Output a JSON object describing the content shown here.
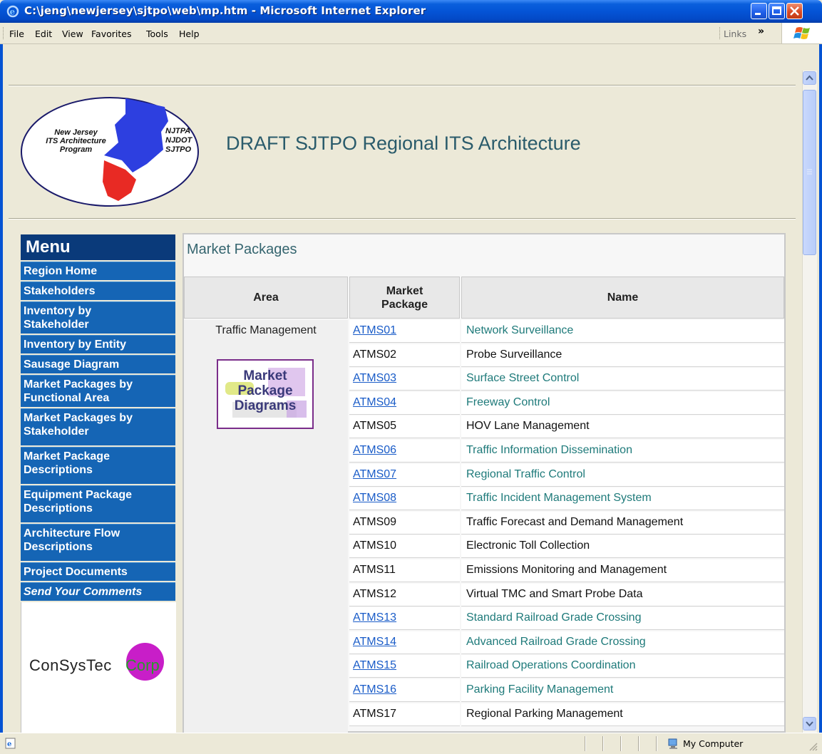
{
  "window": {
    "title": "C:\\jeng\\newjersey\\sjtpo\\web\\mp.htm - Microsoft Internet Explorer"
  },
  "menubar": {
    "items": [
      "File",
      "Edit",
      "View",
      "Favorites",
      "Tools",
      "Help"
    ],
    "links_label": "Links"
  },
  "header": {
    "logo_left": [
      "New Jersey",
      "ITS Architecture",
      "Program"
    ],
    "logo_right": [
      "NJTPA",
      "NJDOT",
      "SJTPO"
    ],
    "title": "DRAFT SJTPO Regional ITS Architecture"
  },
  "sidebar": {
    "heading": "Menu",
    "items": [
      "Region Home",
      "Stakeholders",
      "Inventory by Stakeholder",
      "Inventory by Entity",
      "Sausage Diagram",
      "Market Packages by Functional Area",
      "Market Packages by Stakeholder",
      "Market Package Descriptions",
      "Equipment Package Descriptions",
      "Architecture Flow Descriptions",
      "Project Documents",
      "Send Your Comments"
    ],
    "footer_logo": "ConSysTec",
    "footer_logo_accent": "Corp"
  },
  "main": {
    "section_title": "Market Packages",
    "columns": [
      "Area",
      "Market Package",
      "Name"
    ],
    "area": "Traffic Management",
    "diagram_button": [
      "Market",
      "Package",
      "Diagrams"
    ],
    "rows": [
      {
        "mp": "ATMS01",
        "name": "Network Surveillance",
        "link": true
      },
      {
        "mp": "ATMS02",
        "name": "Probe Surveillance",
        "link": false
      },
      {
        "mp": "ATMS03",
        "name": "Surface Street Control",
        "link": true
      },
      {
        "mp": "ATMS04",
        "name": "Freeway Control",
        "link": true
      },
      {
        "mp": "ATMS05",
        "name": "HOV Lane Management",
        "link": false
      },
      {
        "mp": "ATMS06",
        "name": "Traffic Information Dissemination",
        "link": true
      },
      {
        "mp": "ATMS07",
        "name": "Regional Traffic Control",
        "link": true
      },
      {
        "mp": "ATMS08",
        "name": "Traffic Incident Management System",
        "link": true
      },
      {
        "mp": "ATMS09",
        "name": "Traffic Forecast and Demand Management",
        "link": false
      },
      {
        "mp": "ATMS10",
        "name": "Electronic Toll Collection",
        "link": false
      },
      {
        "mp": "ATMS11",
        "name": "Emissions Monitoring and Management",
        "link": false
      },
      {
        "mp": "ATMS12",
        "name": "Virtual TMC and Smart Probe Data",
        "link": false
      },
      {
        "mp": "ATMS13",
        "name": "Standard Railroad Grade Crossing",
        "link": true
      },
      {
        "mp": "ATMS14",
        "name": "Advanced Railroad Grade Crossing",
        "link": true
      },
      {
        "mp": "ATMS15",
        "name": "Railroad Operations Coordination",
        "link": true
      },
      {
        "mp": "ATMS16",
        "name": "Parking Facility Management",
        "link": true
      },
      {
        "mp": "ATMS17",
        "name": "Regional Parking Management",
        "link": false
      }
    ]
  },
  "statusbar": {
    "zone": "My Computer"
  },
  "colors": {
    "titlebar": "#0454d6",
    "nav_bg": "#1565b5",
    "menu_head_bg": "#0a3a7a",
    "link": "#1a5cc8",
    "name_link": "#1e7a7a"
  }
}
